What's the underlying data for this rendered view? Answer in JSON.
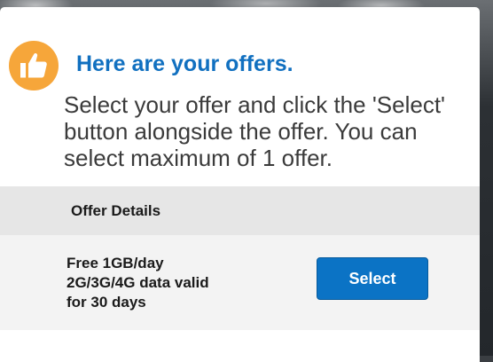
{
  "dialog": {
    "title": "Here are your offers.",
    "instructions": "Select your offer and click the 'Select' button alongside the offer. You can select maximum of 1 offer.",
    "icon": "thumbs-up-icon",
    "colors": {
      "accent": "#1170c0",
      "badge": "#f6a63a",
      "button": "#0b73c5"
    }
  },
  "table": {
    "header": "Offer Details",
    "offers": [
      {
        "description": "Free 1GB/day\n2G/3G/4G data valid\nfor 30 days",
        "select_label": "Select"
      }
    ]
  }
}
